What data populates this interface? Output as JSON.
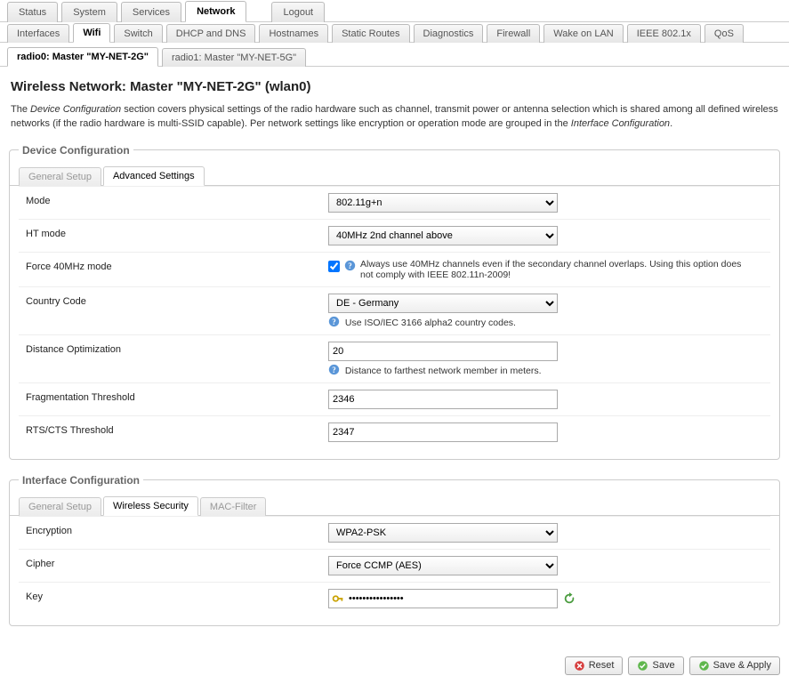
{
  "nav_top": {
    "tabs": [
      {
        "label": "Status",
        "active": false
      },
      {
        "label": "System",
        "active": false
      },
      {
        "label": "Services",
        "active": false
      },
      {
        "label": "Network",
        "active": true
      },
      {
        "label": "Logout",
        "active": false
      }
    ]
  },
  "nav_sub": {
    "tabs": [
      {
        "label": "Interfaces",
        "active": false
      },
      {
        "label": "Wifi",
        "active": true
      },
      {
        "label": "Switch",
        "active": false
      },
      {
        "label": "DHCP and DNS",
        "active": false
      },
      {
        "label": "Hostnames",
        "active": false
      },
      {
        "label": "Static Routes",
        "active": false
      },
      {
        "label": "Diagnostics",
        "active": false
      },
      {
        "label": "Firewall",
        "active": false
      },
      {
        "label": "Wake on LAN",
        "active": false
      },
      {
        "label": "IEEE 802.1x",
        "active": false
      },
      {
        "label": "QoS",
        "active": false
      }
    ]
  },
  "nav_radio": {
    "tabs": [
      {
        "label": "radio0: Master \"MY-NET-2G\"",
        "active": true
      },
      {
        "label": "radio1: Master \"MY-NET-5G\"",
        "active": false
      }
    ]
  },
  "page": {
    "title": "Wireless Network: Master \"MY-NET-2G\" (wlan0)",
    "description_prefix": "The ",
    "description_em1": "Device Configuration",
    "description_mid": " section covers physical settings of the radio hardware such as channel, transmit power or antenna selection which is shared among all defined wireless networks (if the radio hardware is multi-SSID capable). Per network settings like encryption or operation mode are grouped in the ",
    "description_em2": "Interface Configuration",
    "description_suffix": "."
  },
  "device": {
    "legend": "Device Configuration",
    "tabs": [
      {
        "label": "General Setup",
        "active": false
      },
      {
        "label": "Advanced Settings",
        "active": true
      }
    ],
    "mode": {
      "label": "Mode",
      "value": "802.11g+n"
    },
    "htmode": {
      "label": "HT mode",
      "value": "40MHz 2nd channel above"
    },
    "force40": {
      "label": "Force 40MHz mode",
      "checked": true,
      "help": "Always use 40MHz channels even if the secondary channel overlaps. Using this option does not comply with IEEE 802.11n-2009!"
    },
    "country": {
      "label": "Country Code",
      "value": "DE - Germany",
      "help": "Use ISO/IEC 3166 alpha2 country codes."
    },
    "distance": {
      "label": "Distance Optimization",
      "value": "20",
      "help": "Distance to farthest network member in meters."
    },
    "frag": {
      "label": "Fragmentation Threshold",
      "value": "2346"
    },
    "rts": {
      "label": "RTS/CTS Threshold",
      "value": "2347"
    }
  },
  "iface": {
    "legend": "Interface Configuration",
    "tabs": [
      {
        "label": "General Setup",
        "active": false
      },
      {
        "label": "Wireless Security",
        "active": true
      },
      {
        "label": "MAC-Filter",
        "active": false
      }
    ],
    "encryption": {
      "label": "Encryption",
      "value": "WPA2-PSK"
    },
    "cipher": {
      "label": "Cipher",
      "value": "Force CCMP (AES)"
    },
    "key": {
      "label": "Key",
      "value": "••••••••••••••••"
    }
  },
  "actions": {
    "reset": "Reset",
    "save": "Save",
    "save_apply": "Save & Apply"
  }
}
